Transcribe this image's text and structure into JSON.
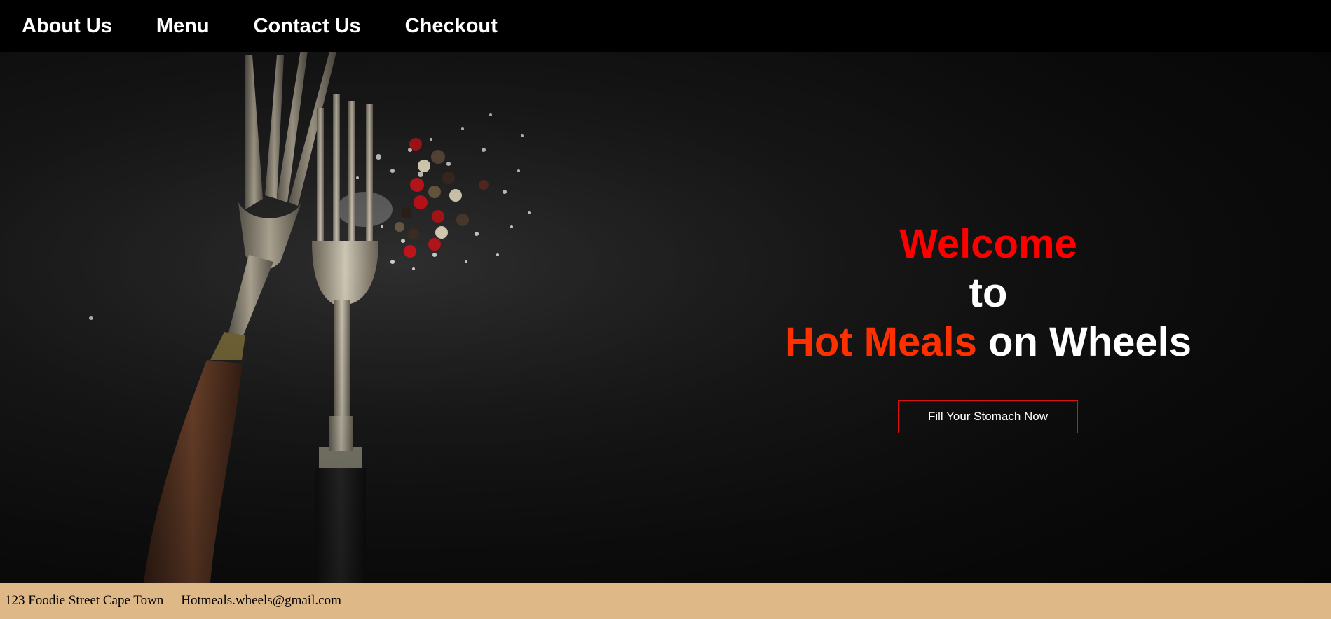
{
  "nav": {
    "items": [
      {
        "label": "About Us"
      },
      {
        "label": "Menu"
      },
      {
        "label": "Contact Us"
      },
      {
        "label": "Checkout"
      }
    ]
  },
  "hero": {
    "welcome": "Welcome",
    "to": "to",
    "brand_highlight": "Hot Meals",
    "brand_rest": "on Wheels",
    "cta_label": "Fill Your Stomach Now",
    "background_icon": "forks-with-peppercorns-photo"
  },
  "footer": {
    "address": "123 Foodie Street Cape Town",
    "email": "Hotmeals.wheels@gmail.com"
  },
  "colors": {
    "nav_bg": "#000000",
    "accent_red": "#ff0000",
    "accent_orange": "#ff3000",
    "footer_bg": "#deb887"
  }
}
